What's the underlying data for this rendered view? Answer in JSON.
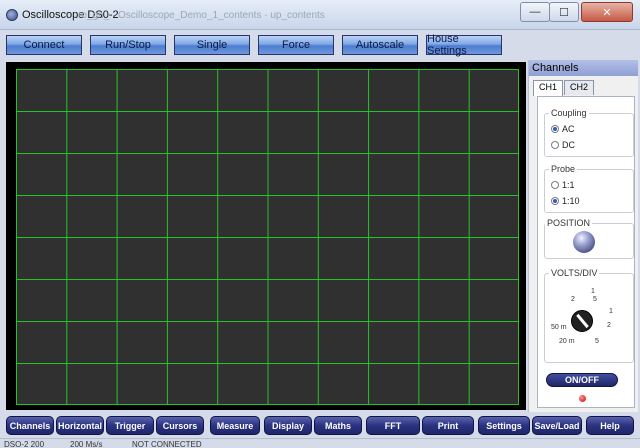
{
  "window": {
    "title": "Oscilloscope DS0-2",
    "background_title": "ro_gn_ · Oscilloscope_Demo_1_contents · up_contents",
    "minimize_label": "—",
    "maximize_label": "☐",
    "close_label": "✕"
  },
  "toolbar": {
    "buttons": [
      "Connect",
      "Run/Stop",
      "Single",
      "Force",
      "Autoscale",
      "House Settings"
    ]
  },
  "panel": {
    "title": "Channels",
    "tabs": [
      "CH1",
      "CH2"
    ],
    "coupling": {
      "label": "Coupling",
      "options": [
        "AC",
        "DC"
      ],
      "selected": "AC"
    },
    "probe": {
      "label": "Probe",
      "options": [
        "1:1",
        "1:10"
      ],
      "selected": "1:10"
    },
    "position": {
      "label": "POSITION"
    },
    "volts_div": {
      "label": "VOLTS/DIV",
      "dial_labels": [
        "1",
        "2",
        "5",
        "1",
        "2",
        "50 m",
        "20 m",
        "5"
      ]
    },
    "onoff_label": "ON/OFF"
  },
  "bottombar": {
    "buttons": [
      "Channels",
      "Horizontal",
      "Trigger",
      "Cursors",
      "Measure",
      "Display",
      "Maths",
      "FFT",
      "Print",
      "Settings",
      "Save/Load",
      "Help"
    ]
  },
  "status": {
    "device": "DSO-2 200",
    "rate": "200 Ms/s",
    "connection": "NOT CONNECTED"
  },
  "colors": {
    "grid_line": "#25c425",
    "screen_bg": "#303030",
    "button_dark": "#2b3380",
    "led": "#d40000"
  }
}
